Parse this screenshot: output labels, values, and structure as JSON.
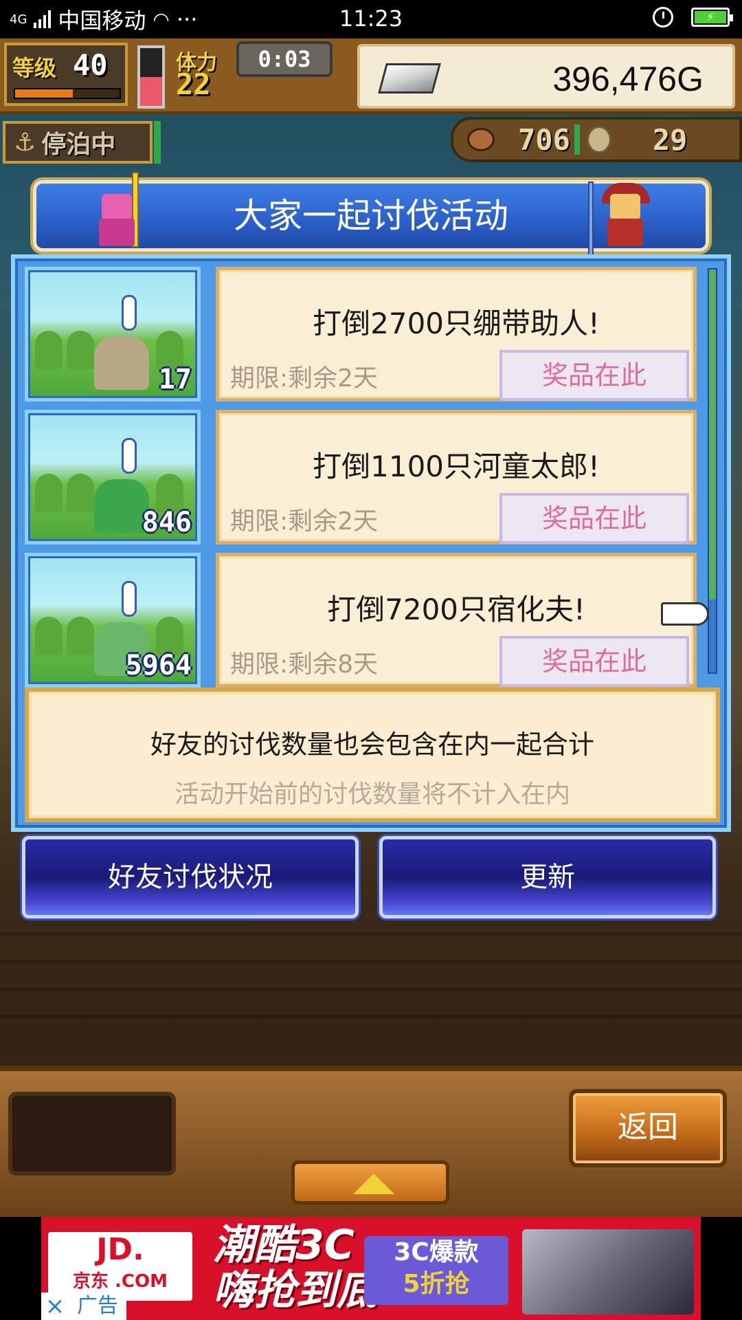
{
  "status_bar": {
    "network": "4G",
    "carrier": "中国移动",
    "dots": "···",
    "time": "11:23",
    "battery_icon": "battery-charging-icon"
  },
  "hud": {
    "level_label": "等级",
    "level_value": "40",
    "stamina_label": "体力",
    "stamina_value": "22",
    "timer": "0:03",
    "gold": "396,476G",
    "anchor_status": "停泊中",
    "meat_value": "706",
    "coin_value": "29"
  },
  "dialog": {
    "title": "大家一起讨伐活动",
    "quests": [
      {
        "count": "17",
        "title": "打倒2700只绷带助人!",
        "deadline": "期限:剩余2天",
        "prize_label": "奖品在此",
        "monster_color": "#b8a888"
      },
      {
        "count": "846",
        "title": "打倒1100只河童太郎!",
        "deadline": "期限:剩余2天",
        "prize_label": "奖品在此",
        "monster_color": "#3aa84a"
      },
      {
        "count": "5964",
        "title": "打倒7200只宿化夫!",
        "deadline": "期限:剩余8天",
        "prize_label": "奖品在此",
        "monster_color": "#6ab86a"
      }
    ],
    "info_main": "好友的讨伐数量也会包含在内一起合计",
    "info_sub": "活动开始前的讨伐数量将不计入在内"
  },
  "buttons": {
    "friends_status": "好友讨伐状况",
    "refresh": "更新",
    "back": "返回"
  },
  "ad": {
    "brand_line1": "JD.",
    "brand_line2": "京东 .COM",
    "headline": "潮酷3C 嗨抢到底",
    "promo_line1": "3C爆款",
    "promo_line2": "5折抢",
    "close": "×",
    "label": "广告"
  },
  "colors": {
    "panel_blue": "#4e9ae6",
    "prize_text": "#e06aa0",
    "deadline_text": "#a89a86",
    "ad_red": "#d8102a"
  }
}
